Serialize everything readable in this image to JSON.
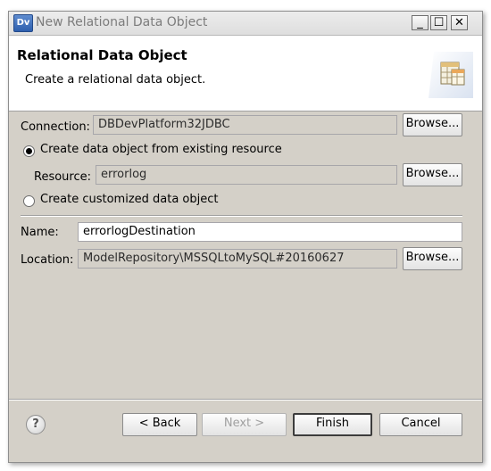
{
  "window": {
    "app_icon_text": "Dv",
    "title": "New Relational Data Object",
    "controls": {
      "minimize": "_",
      "maximize": "☐",
      "close": "✕"
    }
  },
  "header": {
    "title": "Relational Data Object",
    "description": "Create a relational data object."
  },
  "form": {
    "connection_label": "Connection:",
    "connection_value": "DBDevPlatform32JDBC",
    "browse_label": "Browse...",
    "radio_existing_label": "Create data object from existing resource",
    "resource_label": "Resource:",
    "resource_value": "errorlog",
    "radio_custom_label": "Create customized data object",
    "name_label": "Name:",
    "name_value": "errorlogDestination",
    "location_label": "Location:",
    "location_value": "ModelRepository\\MSSQLtoMySQL#20160627",
    "selected_option": "existing"
  },
  "footer": {
    "help_icon": "?",
    "back_label": "< Back",
    "next_label": "Next >",
    "finish_label": "Finish",
    "cancel_label": "Cancel"
  },
  "icons": {
    "app": "dv-app-icon",
    "wizard": "data-object-wizard-icon",
    "help": "help-icon"
  }
}
